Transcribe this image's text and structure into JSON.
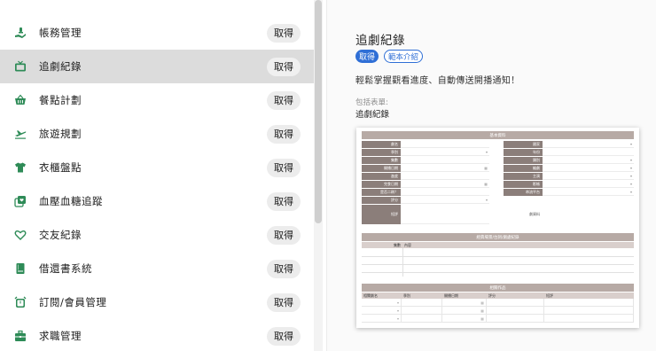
{
  "list": {
    "items": [
      {
        "label": "帳務管理",
        "icon": "money-hand-icon",
        "button": "取得",
        "selected": false
      },
      {
        "label": "追劇紀錄",
        "icon": "tv-icon",
        "button": "取得",
        "selected": true
      },
      {
        "label": "餐點計劃",
        "icon": "basket-icon",
        "button": "取得",
        "selected": false
      },
      {
        "label": "旅遊規劃",
        "icon": "airplane-icon",
        "button": "取得",
        "selected": false
      },
      {
        "label": "衣櫃盤點",
        "icon": "shirt-icon",
        "button": "取得",
        "selected": false
      },
      {
        "label": "血壓血糖追蹤",
        "icon": "heart-monitor-icon",
        "button": "取得",
        "selected": false
      },
      {
        "label": "交友紀錄",
        "icon": "heart-outline-icon",
        "button": "取得",
        "selected": false
      },
      {
        "label": "借還書系統",
        "icon": "book-icon",
        "button": "取得",
        "selected": false
      },
      {
        "label": "訂閱/會員管理",
        "icon": "alarm-icon",
        "button": "取得",
        "selected": false
      },
      {
        "label": "求職管理",
        "icon": "briefcase-icon",
        "button": "取得",
        "selected": false
      }
    ]
  },
  "detail": {
    "title": "追劇紀錄",
    "get_label": "取得",
    "intro_label": "範本介紹",
    "description": "輕鬆掌握觀看進度、自動傳送開播通知！",
    "includes_label": "包括表單:",
    "includes_value": "追劇紀錄"
  },
  "preview": {
    "section1": "基本資料",
    "left_fields": [
      "劇名",
      "季別",
      "集數",
      "開播日期",
      "進度",
      "完食日期",
      "是否二刷？",
      "評分",
      "短評"
    ],
    "right_fields": [
      "國家",
      "年份",
      "類別",
      "編劇",
      "主演",
      "影帳",
      "串流平台",
      "劇資料"
    ],
    "section2": "經典場景/台詞/劇處紀錄",
    "section2_cols": [
      "集數",
      "內容"
    ],
    "section3": "相關作品",
    "section3_cols": [
      "相關劇名",
      "季別",
      "開播日期",
      "評分",
      "短評"
    ]
  },
  "colors": {
    "accent": "#2f6fd6",
    "icon_green": "#2e8b57",
    "selected_row": "#dcdcdc",
    "header_fill": "#b7aaa5",
    "label_fill": "#8b7e7a"
  }
}
